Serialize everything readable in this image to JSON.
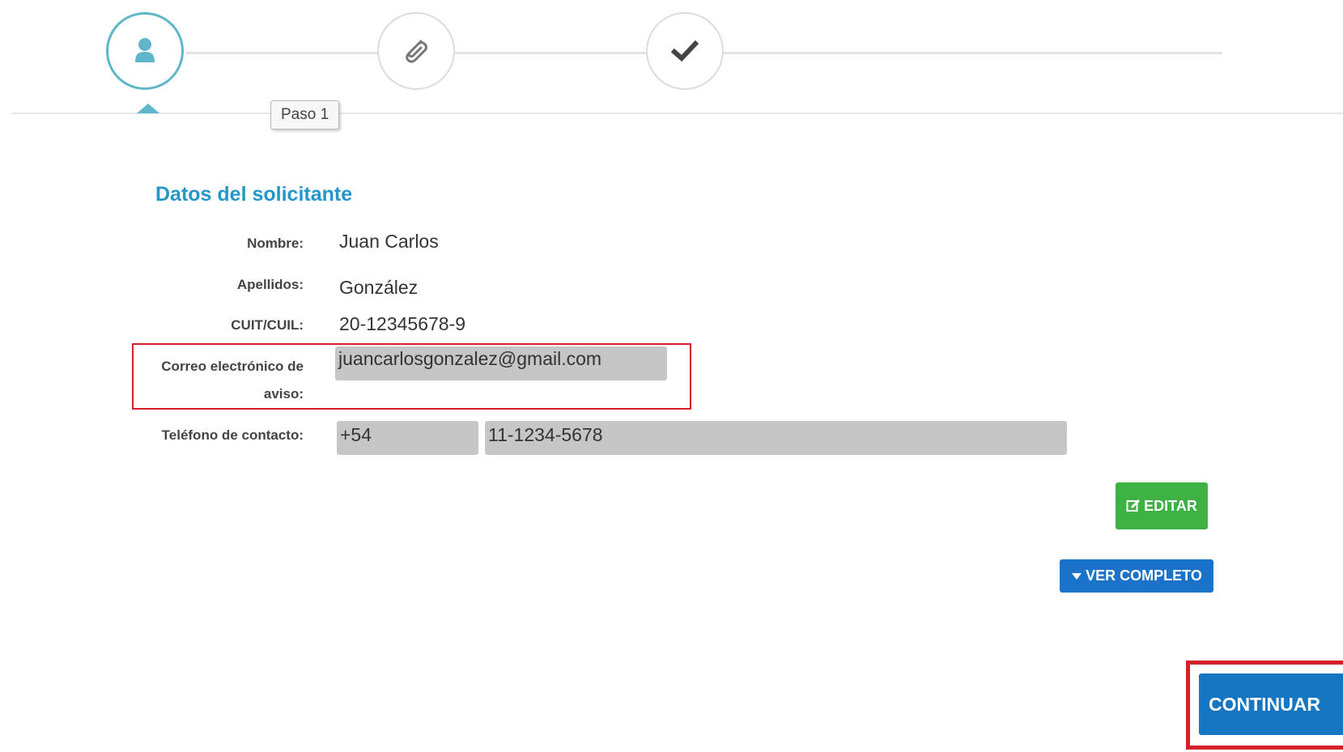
{
  "stepper": {
    "steps": [
      {
        "icon": "user-icon",
        "active": true
      },
      {
        "icon": "paperclip-icon",
        "active": false
      },
      {
        "icon": "checkmark-icon",
        "active": false
      }
    ],
    "tooltip": "Paso 1"
  },
  "form": {
    "title": "Datos del solicitante",
    "nombre": {
      "label": "Nombre:",
      "value": "Juan Carlos"
    },
    "apellidos": {
      "label": "Apellidos:",
      "value": "González"
    },
    "cuit": {
      "label": "CUIT/CUIL:",
      "value": "20-12345678-9"
    },
    "email": {
      "label_line1": "Correo electrónico de",
      "label_line2": "aviso:",
      "value": "juancarlosgonzalez@gmail.com"
    },
    "telefono": {
      "label": "Teléfono de contacto:",
      "code": "+54",
      "number": "11-1234-5678"
    }
  },
  "actions": {
    "editar": "EDITAR",
    "ver_completo": "VER COMPLETO",
    "continuar": "CONTINUAR"
  },
  "colors": {
    "accent": "#2596c9",
    "step_active": "#5fb5c9",
    "editar": "#3db143",
    "primary": "#1776c2",
    "highlight": "#d4202a"
  }
}
